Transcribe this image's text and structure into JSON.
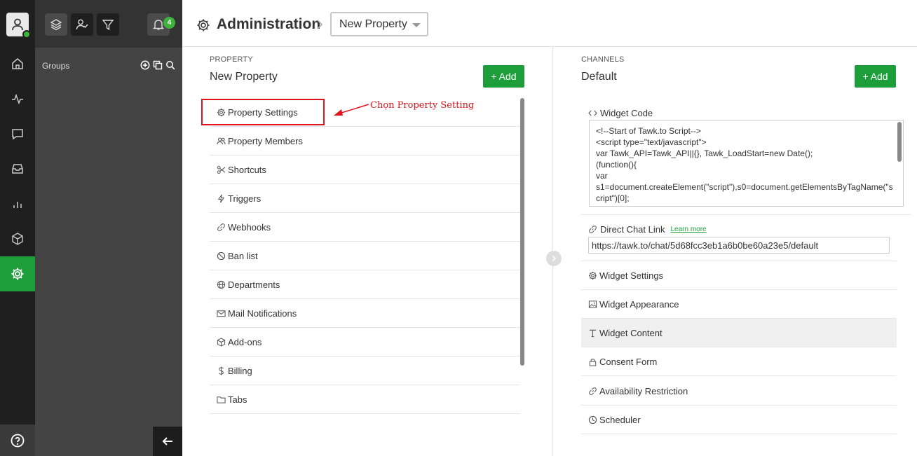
{
  "header": {
    "title": "Administration",
    "property_select": "New Property"
  },
  "notifications": {
    "count": "4"
  },
  "groups": {
    "label": "Groups"
  },
  "property": {
    "section_label": "PROPERTY",
    "name": "New Property",
    "add_label": "+ Add",
    "items": [
      {
        "label": "Property Settings",
        "icon": "gear-icon"
      },
      {
        "label": "Property Members",
        "icon": "members-icon"
      },
      {
        "label": "Shortcuts",
        "icon": "scissors-icon"
      },
      {
        "label": "Triggers",
        "icon": "bolt-icon"
      },
      {
        "label": "Webhooks",
        "icon": "link-icon"
      },
      {
        "label": "Ban list",
        "icon": "ban-icon"
      },
      {
        "label": "Departments",
        "icon": "globe-icon"
      },
      {
        "label": "Mail Notifications",
        "icon": "mail-icon"
      },
      {
        "label": "Add-ons",
        "icon": "cube-icon"
      },
      {
        "label": "Billing",
        "icon": "dollar-icon"
      },
      {
        "label": "Tabs",
        "icon": "folder-icon"
      }
    ]
  },
  "annotation": {
    "text": "Chọn Property Setting",
    "color": "#e0141a"
  },
  "channels": {
    "section_label": "CHANNELS",
    "name": "Default",
    "add_label": "+ Add",
    "widget_code_label": "Widget Code",
    "code_lines": [
      "<!--Start of Tawk.to Script-->",
      "<script type=\"text/javascript\">",
      "var Tawk_API=Tawk_API||{}, Tawk_LoadStart=new Date();",
      "(function(){",
      "var",
      "s1=document.createElement(\"script\"),s0=document.getElementsByTagName(\"script\")[0];"
    ],
    "direct_chat_label": "Direct Chat Link",
    "learn_more": "Learn more",
    "direct_chat_url": "https://tawk.to/chat/5d68fcc3eb1a6b0be60a23e5/default",
    "items": [
      {
        "label": "Widget Settings",
        "icon": "gear-icon"
      },
      {
        "label": "Widget Appearance",
        "icon": "image-icon"
      },
      {
        "label": "Widget Content",
        "icon": "text-icon"
      },
      {
        "label": "Consent Form",
        "icon": "lock-icon"
      },
      {
        "label": "Availability Restriction",
        "icon": "link-icon"
      },
      {
        "label": "Scheduler",
        "icon": "clock-icon"
      }
    ]
  },
  "colors": {
    "accent": "#1d9e3a",
    "rail": "#1f1f1f",
    "groups_panel": "#444444"
  }
}
